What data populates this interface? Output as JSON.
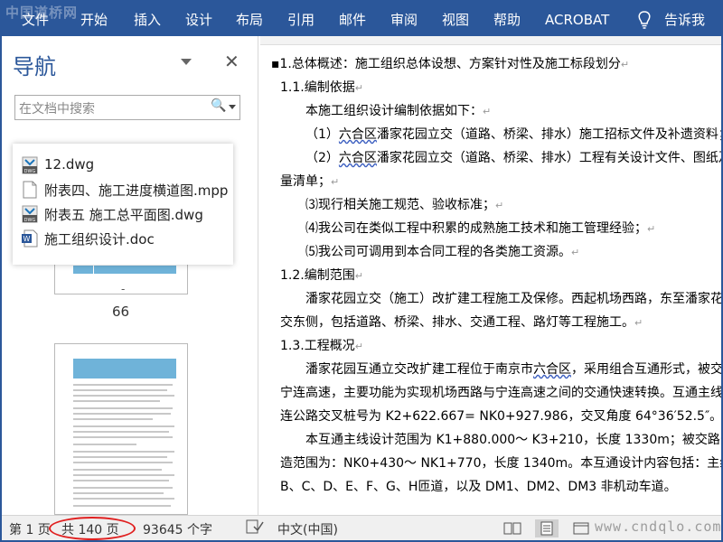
{
  "ribbon": {
    "watermark": "中国道桥网",
    "tabs": [
      "文件",
      "开始",
      "插入",
      "设计",
      "布局",
      "引用",
      "邮件",
      "审阅",
      "视图",
      "帮助",
      "ACROBAT"
    ],
    "tell_me": "告诉我"
  },
  "nav": {
    "title": "导航",
    "search_placeholder": "在文档中搜索",
    "page_label": "66",
    "page_dash": "-"
  },
  "popup": {
    "files": [
      {
        "name": "12.dwg",
        "icon": "dwg-file-icon"
      },
      {
        "name": "附表四、施工进度横道图.mpp",
        "icon": "blank-file-icon"
      },
      {
        "name": "附表五 施工总平面图.dwg",
        "icon": "dwg-file-icon"
      },
      {
        "name": "施工组织设计.doc",
        "icon": "word-file-icon"
      }
    ]
  },
  "doc": {
    "lines": [
      "1.总体概述：施工组织总体设想、方案针对性及施工标段划分",
      "1.1.编制依据",
      "本施工组织设计编制依据如下：",
      "（1）六合区潘家花园立交（道路、桥梁、排水）施工招标文件及补遗资料；",
      "（2）六合区潘家花园立交（道路、桥梁、排水）工程有关设计文件、图纸及工",
      "量清单；",
      "⑶现行相关施工规范、验收标准；",
      "⑷我公司在类似工程中积累的成熟施工技术和施工管理经验；",
      "⑸我公司可调用到本合同工程的各类施工资源。",
      "1.2.编制范围",
      "潘家花园立交（施工）改扩建工程施工及保修。西起机场西路，东至潘家花",
      "交东侧，包括道路、桥梁、排水、交通工程、路灯等工程施工。",
      "1.3.工程概况",
      "潘家花园互通立交改扩建工程位于南京市六合区，采用组合互通形式，被交路",
      "宁连高速，主要功能为实现机场西路与宁连高速之间的交通快速转换。互通主线与",
      "连公路交叉桩号为 K2+622.667= NK0+927.986，交叉角度 64°36′52.5″。",
      "本互通主线设计范围为 K1+880.000～ K3+210，长度 1330m；被交路宁连公路",
      "造范围为：NK0+430～ NK1+770，长度 1340m。本互通设计内容包括：主线高架，",
      "B、C、D、E、F、G、H匝道，以及 DM1、DM2、DM3 非机动车道。"
    ],
    "squiggle_word": "六合区"
  },
  "status": {
    "page": "第 1 页",
    "total": "共 140 页",
    "words": "93645 个字",
    "language": "中文(中国)",
    "site_watermark": "www.cndqlo.com"
  },
  "colors": {
    "ribbon": "#2b579a",
    "highlight_ellipse": "#e02020"
  }
}
